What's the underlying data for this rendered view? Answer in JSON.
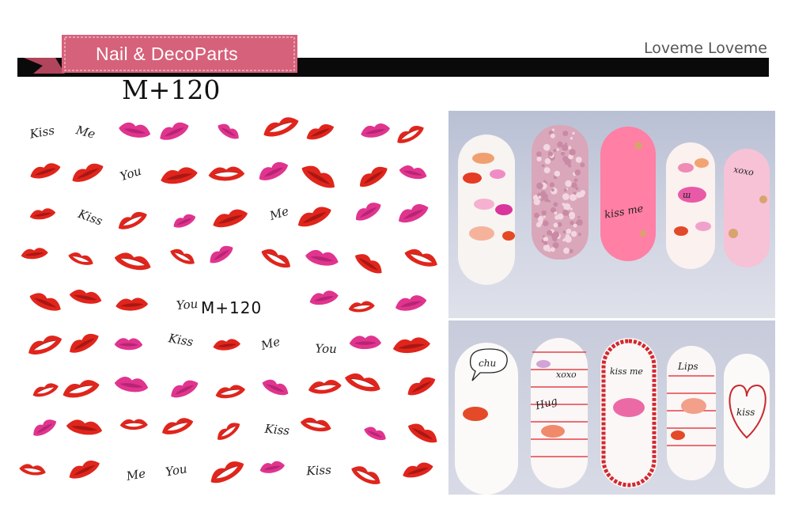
{
  "header": {
    "ribbon_label": "Nail & DecoParts",
    "brand": "Loveme Loveme",
    "product_code": "M+120"
  },
  "sticker_sheet": {
    "code_label": "M+120",
    "script_words": [
      "Kiss",
      "Me",
      "You"
    ]
  },
  "photo_top": {
    "nail_texts": [
      "kiss me",
      "xoxo"
    ]
  },
  "photo_bottom": {
    "nail_texts": [
      "chu",
      "xoxo",
      "Hug",
      "kiss me",
      "Lips",
      "kiss"
    ]
  },
  "colors": {
    "ribbon": "#d6617a",
    "header_bar": "#0a0a0a",
    "lip_red": "#e0251c",
    "lip_pink": "#e0348f"
  }
}
